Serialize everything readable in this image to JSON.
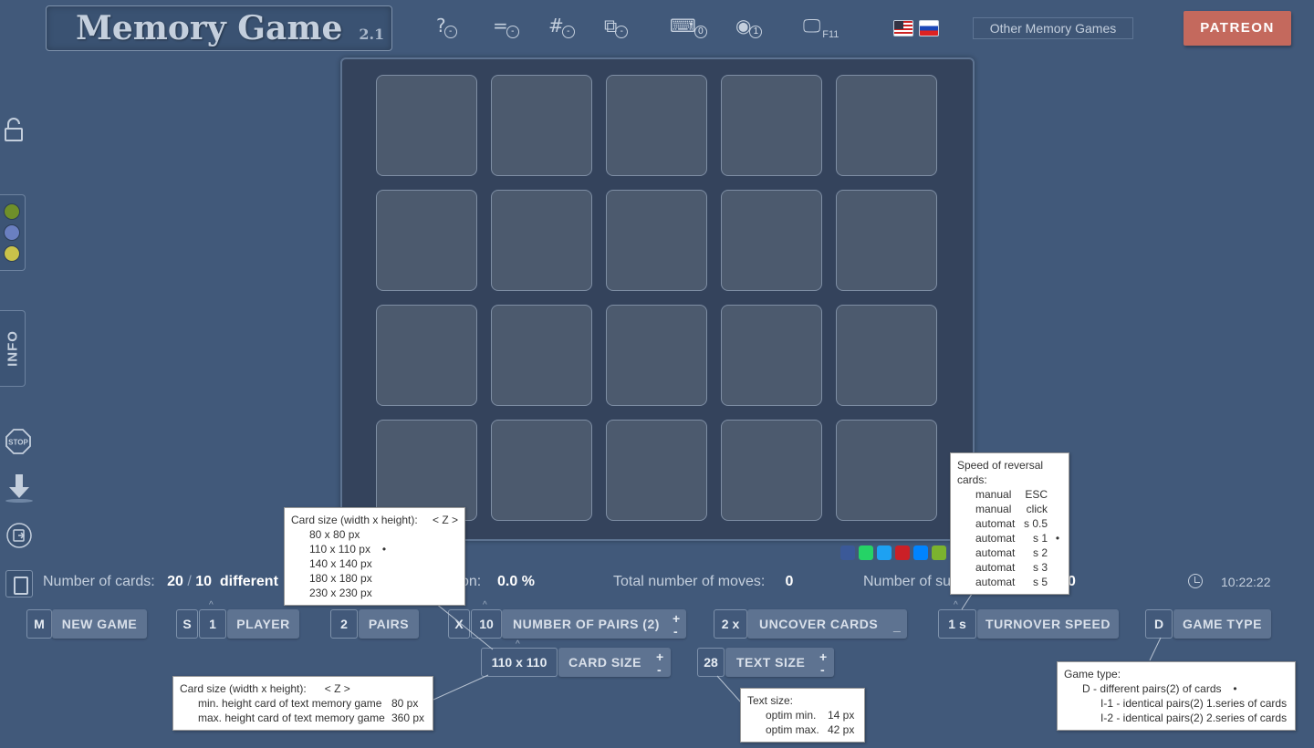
{
  "header": {
    "title": "Memory Game",
    "version": "2.1",
    "tools": [
      {
        "icon": "help-icon",
        "symbol": "?",
        "badge": "-"
      },
      {
        "icon": "equals-icon",
        "symbol": "=",
        "badge": "-"
      },
      {
        "icon": "hash-icon",
        "symbol": "#",
        "badge": "-"
      },
      {
        "icon": "puzzle-icon",
        "symbol": "⧉",
        "badge": "-"
      },
      {
        "icon": "keyboard-icon",
        "symbol": "⌨",
        "badge": "0"
      },
      {
        "icon": "eye-slash-icon",
        "symbol": "◉",
        "badge": "1"
      },
      {
        "icon": "fullscreen-monitor-icon",
        "symbol": "🖵",
        "badge": "F11"
      }
    ],
    "other_games": "Other Memory Games",
    "patreon": "PATREON"
  },
  "sidebar": {
    "info_label": "INFO",
    "colors": [
      "#6f8f2a",
      "#6a7fc0",
      "#c9c24a"
    ]
  },
  "board": {
    "rows": 4,
    "cols": 5,
    "card_count": 20
  },
  "share_colors": [
    "#3b5998",
    "#25d366",
    "#1da1f2",
    "#cb2027",
    "#0084ff",
    "#7bb32e"
  ],
  "stats": {
    "cards_label": "Number of cards:",
    "cards_total": "20",
    "cards_sep": "/",
    "cards_diff": "10",
    "different_label": "different",
    "success_suffix": "on:",
    "success_value": "0.0 %",
    "moves_label": "Total number of moves:",
    "moves_value": "0",
    "succ_prefix": "Number of su",
    "succ_value": "0",
    "time": "10:22:22"
  },
  "controls": {
    "new_game_key": "M",
    "new_game": "NEW GAME",
    "player_key": "S",
    "player_value": "1",
    "player": "PLAYER",
    "pairs_value": "2",
    "pairs": "PAIRS",
    "num_pairs_key": "X",
    "num_pairs_value": "10",
    "num_pairs": "NUMBER OF PAIRS (2)",
    "uncover_value": "2 x",
    "uncover": "UNCOVER CARDS",
    "turnover_value": "1 s",
    "turnover": "TURNOVER SPEED",
    "game_type_key": "D",
    "game_type": "GAME TYPE",
    "card_size_value": "110 x 110",
    "card_size": "CARD SIZE",
    "text_size_value": "28",
    "text_size": "TEXT SIZE",
    "plus": "+",
    "minus": "-",
    "underscore": "_"
  },
  "tooltips": {
    "card_size_menu": {
      "title": "Card size (width x height):",
      "shortcut": "< Z >",
      "options": [
        "80 x 80 px",
        "110 x 110 px",
        "140 x 140 px",
        "180 x 180 px",
        "230 x 230 px"
      ],
      "selected_mark": "•"
    },
    "speed_menu": {
      "title_1": "Speed of reversal",
      "title_2": "cards:",
      "options": [
        {
          "mode": "manual",
          "value": "ESC"
        },
        {
          "mode": "manual",
          "value": "click"
        },
        {
          "mode": "automat",
          "value": "0.5 s"
        },
        {
          "mode": "automat",
          "value": "1 s"
        },
        {
          "mode": "automat",
          "value": "2 s"
        },
        {
          "mode": "automat",
          "value": "3 s"
        },
        {
          "mode": "automat",
          "value": "5 s"
        }
      ],
      "selected_mark": "•"
    },
    "card_size_info": {
      "title": "Card size (width x height):",
      "shortcut": "< Z >",
      "min_label": "min. height card of text memory game",
      "min_value": "80 px",
      "max_label": "max. height card of text memory game",
      "max_value": "360 px"
    },
    "text_size_info": {
      "title": "Text size:",
      "min_label": "optim min.",
      "min_value": "14 px",
      "max_label": "optim max.",
      "max_value": "42 px"
    },
    "game_type_info": {
      "title": "Game type:",
      "d": "D - different pairs(2) of cards",
      "i1": "I-1 - identical pairs(2) 1.series of cards",
      "i2": "I-2 - identical pairs(2) 2.series of cards",
      "selected_mark": "•"
    }
  }
}
